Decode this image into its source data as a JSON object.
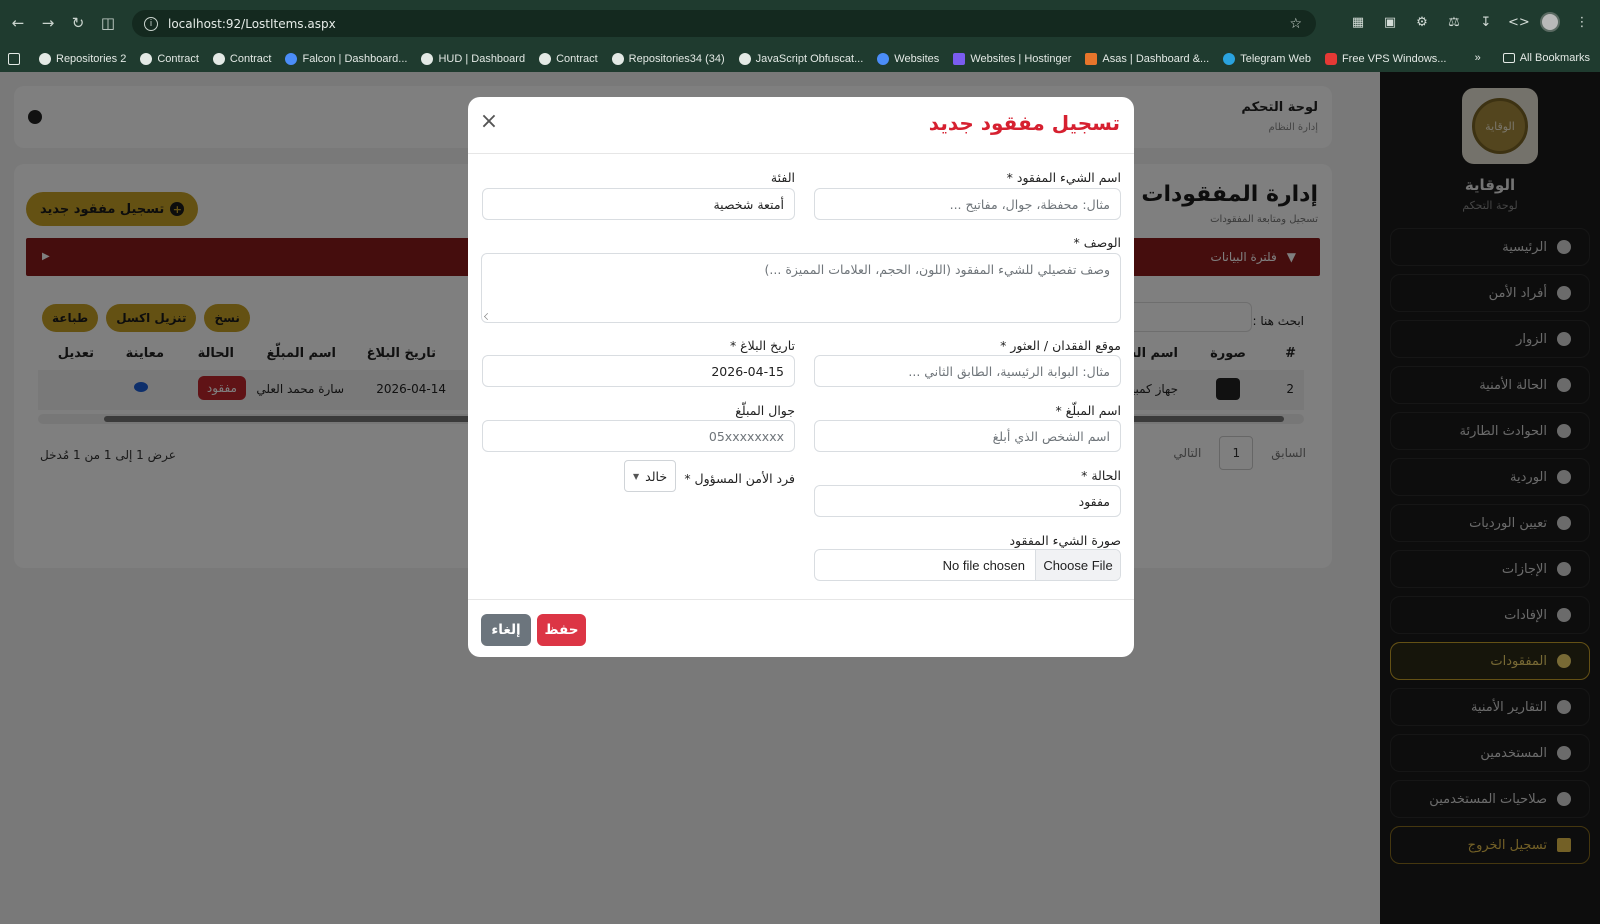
{
  "browser": {
    "url": "localhost:92/LostItems.aspx",
    "bookmarks": [
      {
        "label": "Repositories 2",
        "icon": "github-icon"
      },
      {
        "label": "Contract",
        "icon": "globe-icon"
      },
      {
        "label": "Contract",
        "icon": "globe-icon"
      },
      {
        "label": "Falcon | Dashboard...",
        "icon": "falcon-icon"
      },
      {
        "label": "HUD | Dashboard",
        "icon": "globe-icon"
      },
      {
        "label": "Contract",
        "icon": "globe-icon"
      },
      {
        "label": "Repositories34 (34)",
        "icon": "github-icon"
      },
      {
        "label": "JavaScript Obfuscat...",
        "icon": "js-icon"
      },
      {
        "label": "Websites",
        "icon": "websites-icon"
      },
      {
        "label": "Websites | Hostinger",
        "icon": "hostinger-icon"
      },
      {
        "label": "Asas | Dashboard &...",
        "icon": "asas-icon"
      },
      {
        "label": "Telegram Web",
        "icon": "telegram-icon"
      },
      {
        "label": "Free VPS Windows...",
        "icon": "youtube-icon"
      }
    ],
    "more": "»",
    "all_bookmarks": "All Bookmarks"
  },
  "header": {
    "title": "لوحة التحكم",
    "subtitle": "إدارة النظام"
  },
  "sidebar": {
    "brand": "الوقاية",
    "brand_sub": "لوحة التحكم",
    "logo_text": "الوقاية",
    "items": [
      {
        "label": "الرئيسية",
        "icon": "dashboard-icon"
      },
      {
        "label": "أفراد الأمن",
        "icon": "user-shield-icon"
      },
      {
        "label": "الزوار",
        "icon": "id-card-icon"
      },
      {
        "label": "الحالة الأمنية",
        "icon": "shield-icon"
      },
      {
        "label": "الحوادث الطارئة",
        "icon": "warning-icon"
      },
      {
        "label": "الوردية",
        "icon": "calendar-icon"
      },
      {
        "label": "تعيين الورديات",
        "icon": "clock-icon"
      },
      {
        "label": "الإجازات",
        "icon": "plane-icon"
      },
      {
        "label": "الإفادات",
        "icon": "edit-icon"
      },
      {
        "label": "المفقودات",
        "icon": "search-icon"
      },
      {
        "label": "التقارير الأمنية",
        "icon": "file-icon"
      },
      {
        "label": "المستخدمين",
        "icon": "user-icon"
      },
      {
        "label": "صلاحيات المستخدمين",
        "icon": "users-icon"
      },
      {
        "label": "تسجيل الخروج",
        "icon": "logout-icon"
      }
    ]
  },
  "page": {
    "title": "إدارة المفقودات",
    "subtitle": "تسجيل ومتابعة المفقودات",
    "add_button": "تسجيل مفقود جديد",
    "filter": "فلترة البيانات",
    "search_label": "ابحث هنا :",
    "tools": [
      "طباعة",
      "تنزيل اكسل",
      "نسخ"
    ],
    "columns": [
      "#",
      "صورة",
      "اسم الشيء المفقود",
      "تاريخ البلاغ",
      "اسم المبلّغ",
      "الحالة",
      "معاينة",
      "تعديل"
    ],
    "row": {
      "num": "2",
      "item": "جهاز كمبيوتر محمول",
      "date": "2026-04-14",
      "reporter": "سارة محمد العلي",
      "status": "مفقود"
    },
    "info": "عرض 1 إلى 1 من 1 مُدخل",
    "pager": {
      "prev": "السابق",
      "page": "1",
      "next": "التالي"
    }
  },
  "modal": {
    "title": "تسجيل مفقود جديد",
    "item_name_label": "اسم الشيء المفقود *",
    "item_name_placeholder": "مثال: محفظة، جوال، مفاتيح ...",
    "category_label": "الفئة",
    "category_value": "أمتعة شخصية",
    "description_label": "الوصف *",
    "description_placeholder": "وصف تفصيلي للشيء المفقود (اللون، الحجم، العلامات المميزة ...)",
    "location_label": "موقع الفقدان / العثور *",
    "location_placeholder": "مثال: البوابة الرئيسية، الطابق الثاني ...",
    "report_date_label": "تاريخ البلاغ *",
    "report_date_value": "2026-04-15",
    "reporter_label": "اسم المبلّغ *",
    "reporter_placeholder": "اسم الشخص الذي أبلغ",
    "phone_label": "جوال المبلّغ",
    "phone_placeholder": "05xxxxxxxx",
    "status_label": "الحالة *",
    "status_value": "مفقود",
    "officer_label": "فرد الأمن المسؤول *",
    "officer_value": "خالد",
    "photo_label": "صورة الشيء المفقود",
    "file_button": "Choose File",
    "file_status": "No file chosen",
    "save": "حفظ",
    "cancel": "إلغاء"
  }
}
